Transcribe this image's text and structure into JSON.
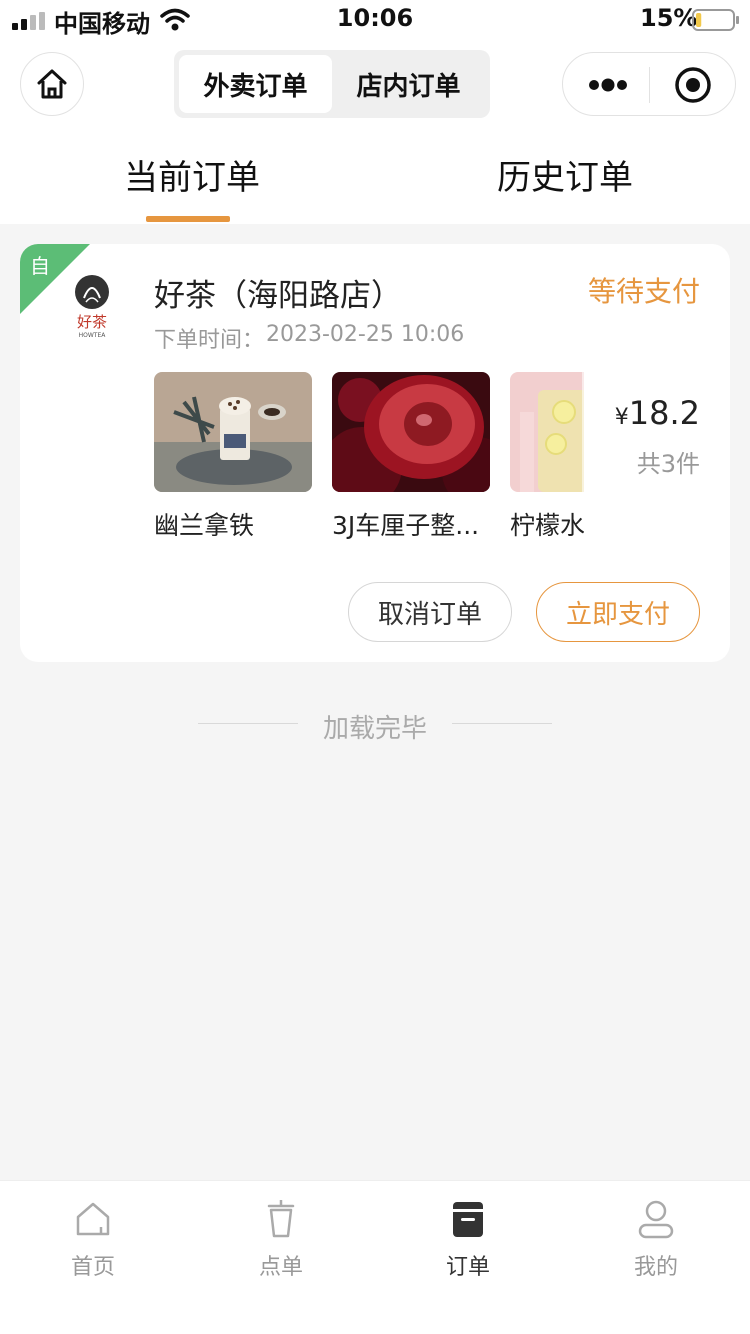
{
  "status_bar": {
    "carrier": "中国移动",
    "time": "10:06",
    "battery_percent": "15%",
    "battery_level": 0.15,
    "icons": [
      "signal-icon",
      "wifi-icon",
      "battery-icon"
    ]
  },
  "navbar": {
    "home_icon": "home-icon",
    "segments": [
      {
        "label": "外卖订单",
        "active": true
      },
      {
        "label": "店内订单",
        "active": false
      }
    ],
    "capsule_icons": [
      "more-icon",
      "close-target-icon"
    ]
  },
  "order_tabs": {
    "tabs": [
      {
        "label": "当前订单",
        "active": true
      },
      {
        "label": "历史订单",
        "active": false
      }
    ],
    "accent_color": "#e6963f"
  },
  "order": {
    "badge": "自",
    "badge_color": "#5cbd76",
    "shop_name": "好茶（海阳路店）",
    "status": "等待支付",
    "time_label": "下单时间：",
    "time": "2023-02-25 10:06",
    "products": [
      {
        "name": "幽兰拿铁"
      },
      {
        "name": "3J车厘子整..."
      },
      {
        "name": "柠檬水"
      }
    ],
    "currency": "¥",
    "price": "18.2",
    "count_text": "共3件",
    "cancel_label": "取消订单",
    "pay_label": "立即支付",
    "logo": {
      "brand": "好茶",
      "sub": "HOWTEA"
    }
  },
  "footer_text": "加载完毕",
  "tabbar": {
    "items": [
      {
        "label": "首页",
        "icon": "home-outline-icon",
        "active": false
      },
      {
        "label": "点单",
        "icon": "cup-icon",
        "active": false
      },
      {
        "label": "订单",
        "icon": "order-list-icon",
        "active": true
      },
      {
        "label": "我的",
        "icon": "user-icon",
        "active": false
      }
    ]
  }
}
